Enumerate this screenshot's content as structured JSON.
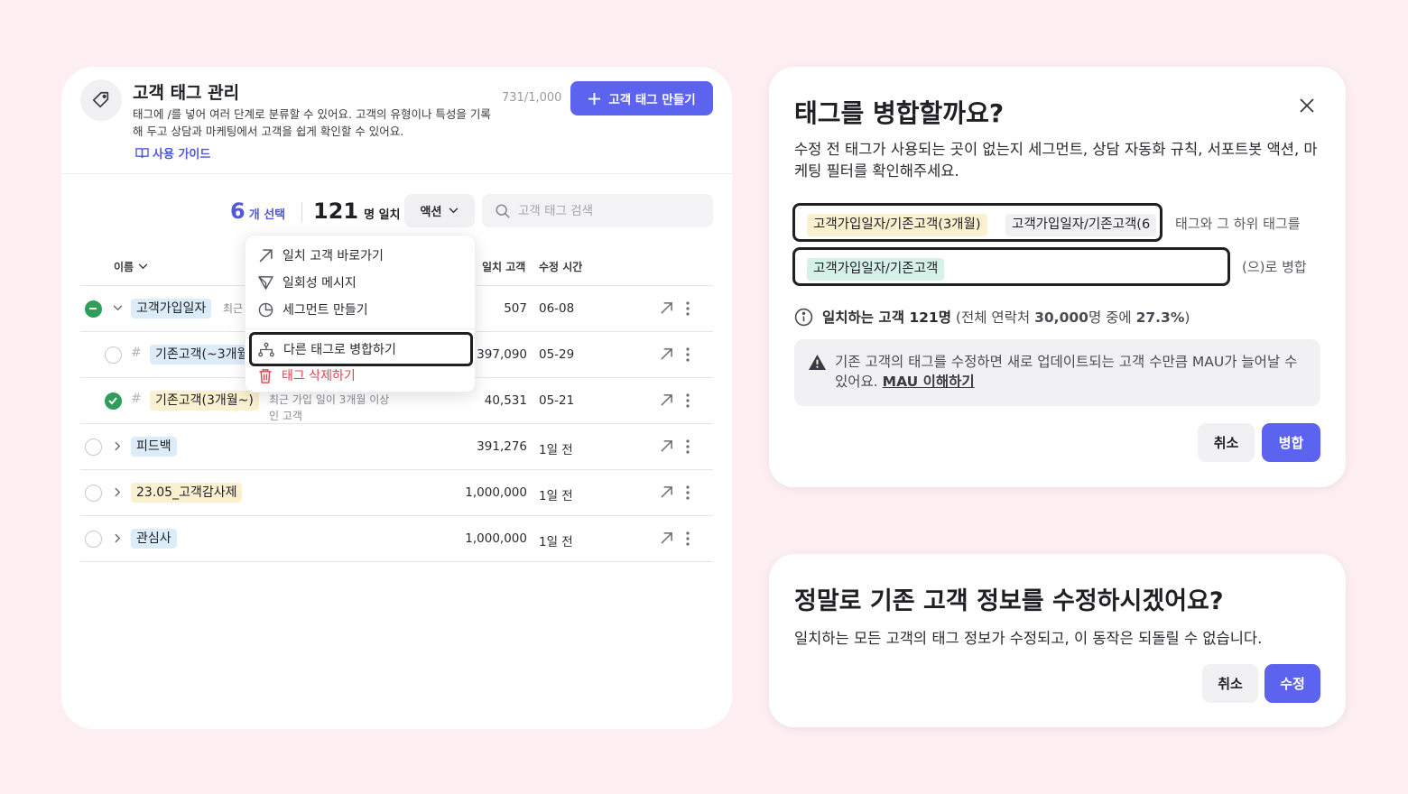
{
  "tag_manager": {
    "title": "고객 태그 관리",
    "description": "태그에 /를 넣어 여러 단계로 분류할 수 있어요. 고객의 유형이나 특성을 기록해 두고 상담과 마케팅에서 고객을 쉽게 확인할 수 있어요.",
    "guide_link": "사용 가이드",
    "tag_count": "731/1,000",
    "create_button": "고객 태그 만들기",
    "selected_num": "6",
    "selected_label": "개 선택",
    "match_num": "121",
    "match_label": "명 일치",
    "action_label": "액션",
    "search_placeholder": "고객 태그 검색",
    "columns": {
      "name": "이름",
      "match": "일치 고객",
      "modified": "수정 시간"
    },
    "rows": [
      {
        "tag": "고객가입일자",
        "desc": "최근",
        "match": "507",
        "modified": "06-08",
        "state": "partial"
      },
      {
        "tag": "기존고객(~3개월)",
        "desc": "",
        "match": "397,090",
        "modified": "05-29",
        "state": "unchecked"
      },
      {
        "tag": "기존고객(3개월~)",
        "desc": "최근 가입 일이 3개월 이상 인 고객",
        "match": "40,531",
        "modified": "05-21",
        "state": "checked"
      },
      {
        "tag": "피드백",
        "desc": "",
        "match": "391,276",
        "modified": "1일 전",
        "state": "unchecked"
      },
      {
        "tag": "23.05_고객감사제",
        "desc": "",
        "match": "1,000,000",
        "modified": "1일 전",
        "state": "unchecked"
      },
      {
        "tag": "관심사",
        "desc": "",
        "match": "1,000,000",
        "modified": "1일 전",
        "state": "unchecked"
      }
    ],
    "row3_desc_line1": "최근 가입 일이 3개월 이상",
    "row3_desc_line2": "인 고객",
    "menu": {
      "go_to_customers": "일치 고객 바로가기",
      "one_time_message": "일회성 메시지",
      "create_segment": "세그먼트 만들기",
      "merge_tag": "다른 태그로 병합하기",
      "delete_tag": "태그 삭제하기"
    }
  },
  "merge_modal": {
    "title": "태그를 병합할까요?",
    "description": "수정 전 태그가 사용되는 곳이 없는지 세그먼트, 상담 자동화 규칙, 서포트봇 액션, 마케팅 필터를 확인해주세요.",
    "source_tags": [
      "고객가입일자/기존고객(3개월)",
      "고객가입일자/기존고객(6"
    ],
    "source_suffix": "태그와 그 하위 태그를",
    "target_tag": "고객가입일자/기존고객",
    "target_suffix": "(으)로 병합",
    "match_info_label": "일치하는 고객 121명",
    "match_info_detail_prefix": "(전체 연락처 ",
    "match_info_total": "30,000",
    "match_info_detail_mid": "명 중에 ",
    "match_info_pct": "27.3%",
    "match_info_detail_suffix": ")",
    "warning_text": "기존 고객의 태그를 수정하면 새로 업데이트되는 고객 수만큼 MAU가 늘어날 수 있어요.",
    "warning_link": "MAU 이해하기",
    "cancel": "취소",
    "confirm": "병합"
  },
  "confirm_modal": {
    "title": "정말로 기존 고객 정보를 수정하시겠어요?",
    "description": "일치하는 모든 고객의 태그 정보가 수정되고, 이 동작은 되돌릴 수 없습니다.",
    "cancel": "취소",
    "confirm": "수정"
  },
  "colors": {
    "background": "#fdeef1",
    "primary": "#5b63ef",
    "link": "#5159d8",
    "check_green": "#2f9e5a",
    "danger": "#e0444f"
  }
}
